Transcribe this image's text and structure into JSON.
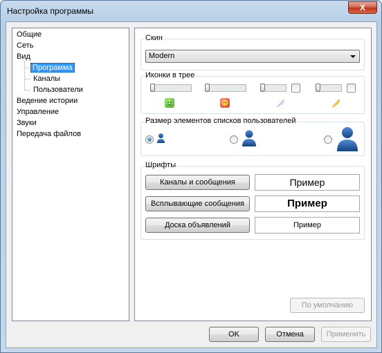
{
  "window": {
    "title": "Настройка программы",
    "close_symbol": "X"
  },
  "tree": {
    "items": [
      {
        "label": "Общие"
      },
      {
        "label": "Сеть"
      },
      {
        "label": "Вид"
      },
      {
        "label": "Программа",
        "selected": true
      },
      {
        "label": "Каналы"
      },
      {
        "label": "Пользователи"
      },
      {
        "label": "Ведение истории"
      },
      {
        "label": "Управление"
      },
      {
        "label": "Звуки"
      },
      {
        "label": "Передача файлов"
      }
    ]
  },
  "skin": {
    "label": "Скин",
    "value": "Modern"
  },
  "tray_icons": {
    "label": "Иконки в трее",
    "icons": [
      "smile-green-icon",
      "angry-red-icon",
      "feather-lavender-icon",
      "feather-yellow-icon"
    ]
  },
  "user_list_size": {
    "label": "Размер элементов списков пользователей",
    "options": [
      "small",
      "medium",
      "large"
    ],
    "selected": 0
  },
  "fonts": {
    "label": "Шрифты",
    "rows": [
      {
        "button": "Каналы и сообщения",
        "sample": "Пример"
      },
      {
        "button": "Всплывающие сообщения",
        "sample": "Пример"
      },
      {
        "button": "Доска объявлений",
        "sample": "Пример"
      }
    ]
  },
  "defaults_button": "По умолчанию",
  "footer": {
    "ok": "OK",
    "cancel": "Отмена",
    "apply": "Применить"
  },
  "colors": {
    "accent_selection": "#3399ff",
    "user_icon": "#1f5aa6"
  }
}
